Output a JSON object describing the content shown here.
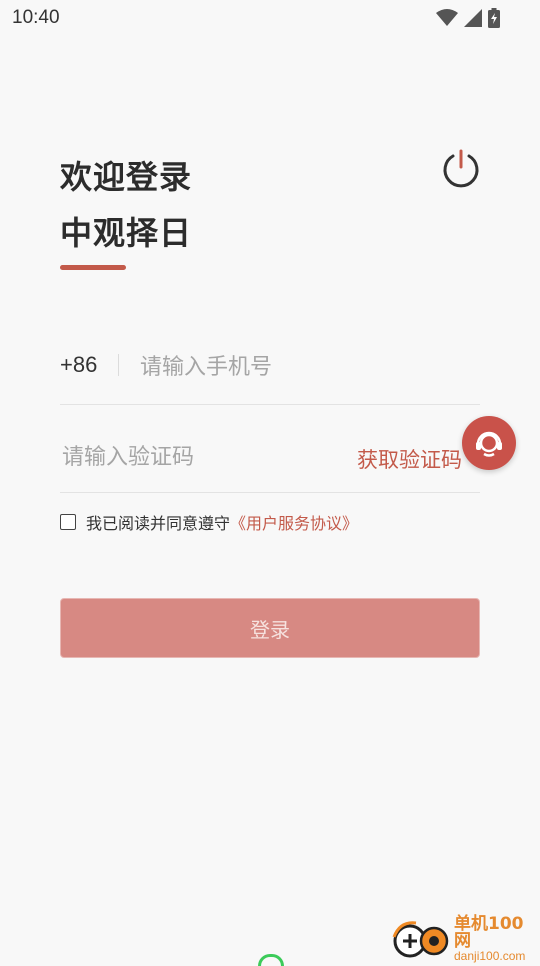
{
  "status_bar": {
    "time": "10:40"
  },
  "header": {
    "welcome": "欢迎登录",
    "app_name": "中观择日"
  },
  "phone": {
    "country_code": "+86",
    "placeholder": "请输入手机号"
  },
  "code": {
    "placeholder": "请输入验证码",
    "get_code_label": "获取验证码"
  },
  "agreement": {
    "text": "我已阅读并同意遵守",
    "link": "《用户服务协议》",
    "checked": false
  },
  "login": {
    "label": "登录"
  },
  "watermark": {
    "name": "单机100网",
    "url": "danji100.com"
  },
  "colors": {
    "accent": "#c35a4a",
    "login_button": "#d78983",
    "background": "#f8f8f8"
  },
  "icons": {
    "power": "power-icon",
    "support": "headset-icon"
  }
}
